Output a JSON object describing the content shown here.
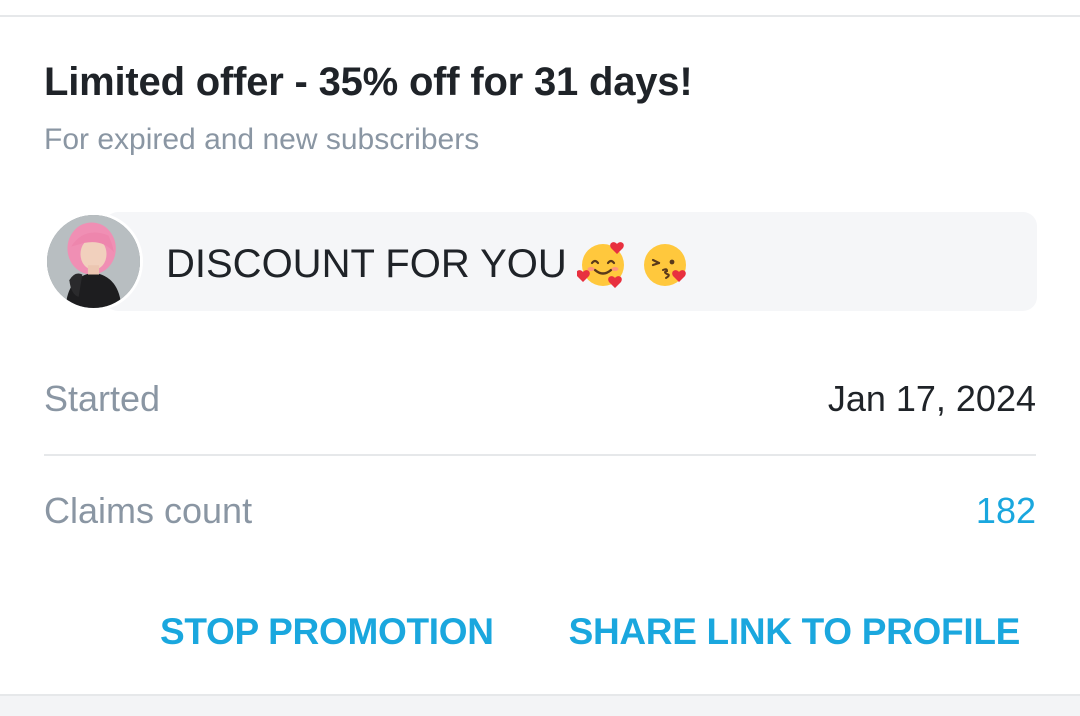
{
  "promo": {
    "title": "Limited offer - 35% off for 31 days!",
    "subtitle": "For expired and new subscribers",
    "message": "DISCOUNT FOR YOU",
    "emojis": [
      "smiling-face-with-hearts-icon",
      "face-blowing-kiss-icon"
    ]
  },
  "details": {
    "started_label": "Started",
    "started_value": "Jan 17, 2024",
    "claims_label": "Claims count",
    "claims_value": "182"
  },
  "actions": {
    "stop_label": "STOP PROMOTION",
    "share_label": "SHARE LINK TO PROFILE"
  },
  "colors": {
    "accent": "#1aa7de",
    "muted_text": "#8a96a3",
    "primary_text": "#1f2328",
    "bubble_bg": "#f5f6f8",
    "divider": "#e6e8ea"
  }
}
